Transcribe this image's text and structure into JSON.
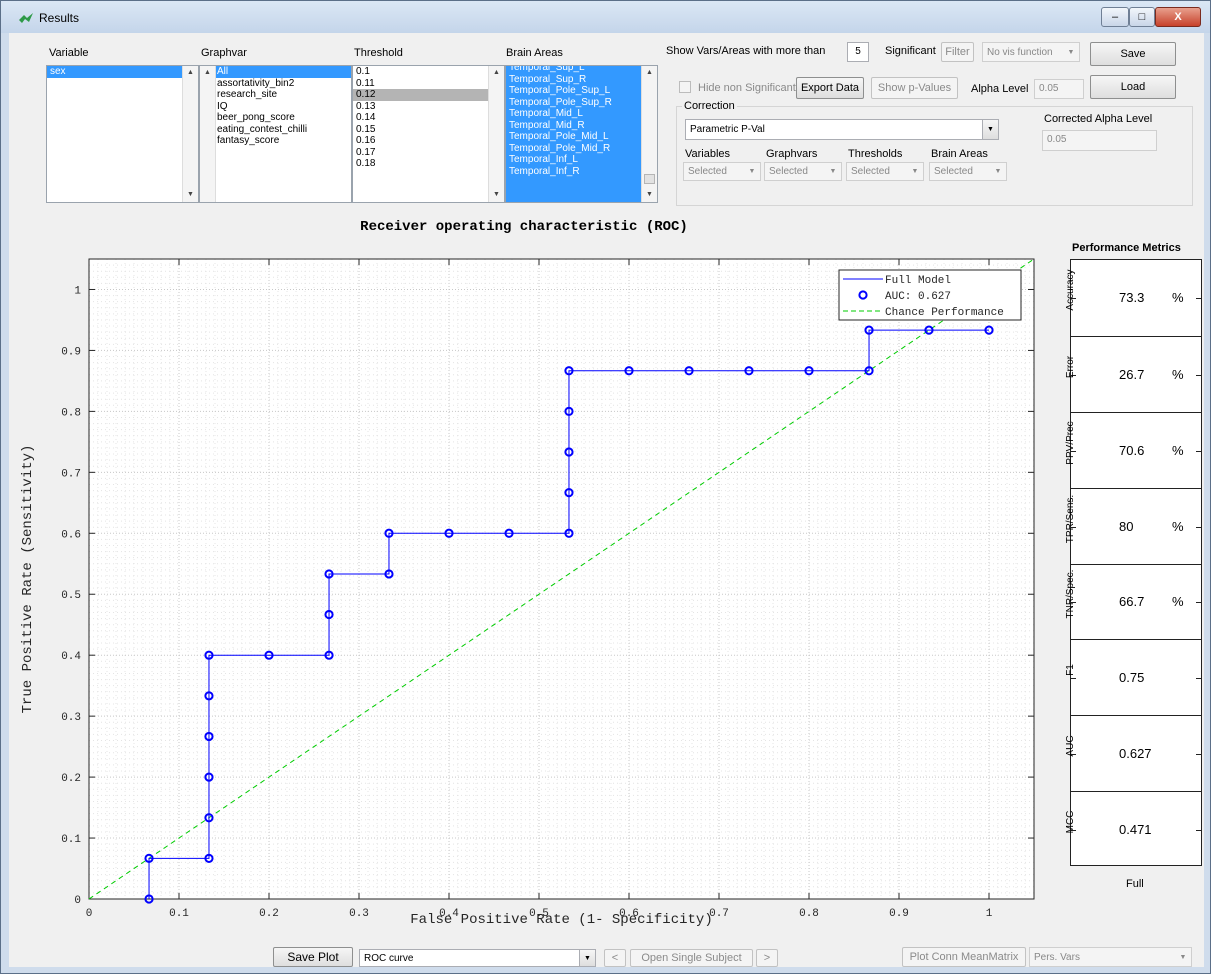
{
  "window": {
    "title": "Results",
    "minimize": "–",
    "maximize": "□",
    "close": "X"
  },
  "lists": {
    "variable": {
      "label": "Variable",
      "items": [
        "sex"
      ],
      "selected": [
        0
      ]
    },
    "graphvar": {
      "label": "Graphvar",
      "items": [
        "All",
        "assortativity_bin2",
        "research_site",
        "IQ",
        "beer_pong_score",
        "eating_contest_chilli",
        "fantasy_score"
      ],
      "selected": [
        0
      ]
    },
    "threshold": {
      "label": "Threshold",
      "items": [
        "0.1",
        "0.11",
        "0.12",
        "0.13",
        "0.14",
        "0.15",
        "0.16",
        "0.17",
        "0.18"
      ],
      "highlighted": [
        2
      ]
    },
    "brain_areas": {
      "label": "Brain Areas",
      "items": [
        "Temporal_Sup_L",
        "Temporal_Sup_R",
        "Temporal_Pole_Sup_L",
        "Temporal_Pole_Sup_R",
        "Temporal_Mid_L",
        "Temporal_Mid_R",
        "Temporal_Pole_Mid_L",
        "Temporal_Pole_Mid_R",
        "Temporal_Inf_L",
        "Temporal_Inf_R"
      ]
    }
  },
  "controls": {
    "show_vars_label": "Show Vars/Areas with more than",
    "show_vars_value": "5",
    "significant_label": "Significant",
    "filter_button": "Filter",
    "vis_function": "No vis function",
    "save_button": "Save",
    "load_button": "Load",
    "hide_non_significant": "Hide non Significant",
    "export_data": "Export Data",
    "show_p_values": "Show p-Values",
    "alpha_label": "Alpha Level",
    "alpha_value": "0.05",
    "correction_label": "Correction",
    "correction_value": "Parametric P-Val",
    "corrected_alpha_label": "Corrected Alpha Level",
    "corrected_alpha_value": "0.05",
    "scopes": [
      {
        "label": "Variables",
        "value": "Selected"
      },
      {
        "label": "Graphvars",
        "value": "Selected"
      },
      {
        "label": "Thresholds",
        "value": "Selected"
      },
      {
        "label": "Brain Areas",
        "value": "Selected"
      }
    ]
  },
  "bottom": {
    "save_plot": "Save Plot",
    "plot_type": "ROC curve",
    "prev": "<",
    "open_single_subject": "Open Single Subject",
    "next": ">",
    "plot_conn_mean_matrix": "Plot Conn MeanMatrix",
    "pers_vars": "Pers. Vars"
  },
  "metrics": {
    "title": "Performance Metrics",
    "column_label": "Full",
    "rows": [
      {
        "name": "Accuracy",
        "value": "73.3",
        "unit": "%"
      },
      {
        "name": "Error",
        "value": "26.7",
        "unit": "%"
      },
      {
        "name": "PPV/Prec",
        "value": "70.6",
        "unit": "%"
      },
      {
        "name": "TPR/Sens.",
        "value": "80",
        "unit": "%"
      },
      {
        "name": "TNR/Spec.",
        "value": "66.7",
        "unit": "%"
      },
      {
        "name": "F1",
        "value": "0.75",
        "unit": ""
      },
      {
        "name": "AUC",
        "value": "0.627",
        "unit": ""
      },
      {
        "name": "MCC",
        "value": "0.471",
        "unit": ""
      }
    ]
  },
  "chart_data": {
    "type": "line",
    "title": "Receiver operating characteristic (ROC)",
    "xlabel": "False Positive Rate (1- Specificity)",
    "ylabel": "True Positive Rate (Sensitivity)",
    "xlim": [
      0,
      1.05
    ],
    "ylim": [
      0,
      1.05
    ],
    "xticks": [
      "0",
      "0.1",
      "0.2",
      "0.3",
      "0.4",
      "0.5",
      "0.6",
      "0.7",
      "0.8",
      "0.9",
      "1"
    ],
    "yticks": [
      "0",
      "0.1",
      "0.2",
      "0.3",
      "0.4",
      "0.5",
      "0.6",
      "0.7",
      "0.8",
      "0.9",
      "1"
    ],
    "grid": true,
    "legend_position": "top-right",
    "colors": {
      "model": "#0000ff",
      "chance": "#00cc00"
    },
    "series": [
      {
        "name": "Full Model",
        "style": "line-with-circle-markers",
        "x": [
          0.0667,
          0.0667,
          0.1333,
          0.1333,
          0.1333,
          0.1333,
          0.1333,
          0.1333,
          0.2,
          0.2667,
          0.2667,
          0.2667,
          0.3333,
          0.3333,
          0.4,
          0.4667,
          0.5333,
          0.5333,
          0.5333,
          0.5333,
          0.5333,
          0.6,
          0.6667,
          0.7333,
          0.8,
          0.8667,
          0.8667,
          0.9333,
          1.0
        ],
        "y": [
          0,
          0.0667,
          0.0667,
          0.1333,
          0.2,
          0.2667,
          0.3333,
          0.4,
          0.4,
          0.4,
          0.4667,
          0.5333,
          0.5333,
          0.6,
          0.6,
          0.6,
          0.6,
          0.6667,
          0.7333,
          0.8,
          0.8667,
          0.8667,
          0.8667,
          0.8667,
          0.8667,
          0.8667,
          0.9333,
          0.9333,
          0.9333
        ]
      },
      {
        "name": "AUC: 0.627",
        "style": "legend-marker-only"
      },
      {
        "name": "Chance Performance",
        "style": "dashed",
        "x": [
          0,
          1.05
        ],
        "y": [
          0,
          1.05
        ]
      }
    ]
  }
}
